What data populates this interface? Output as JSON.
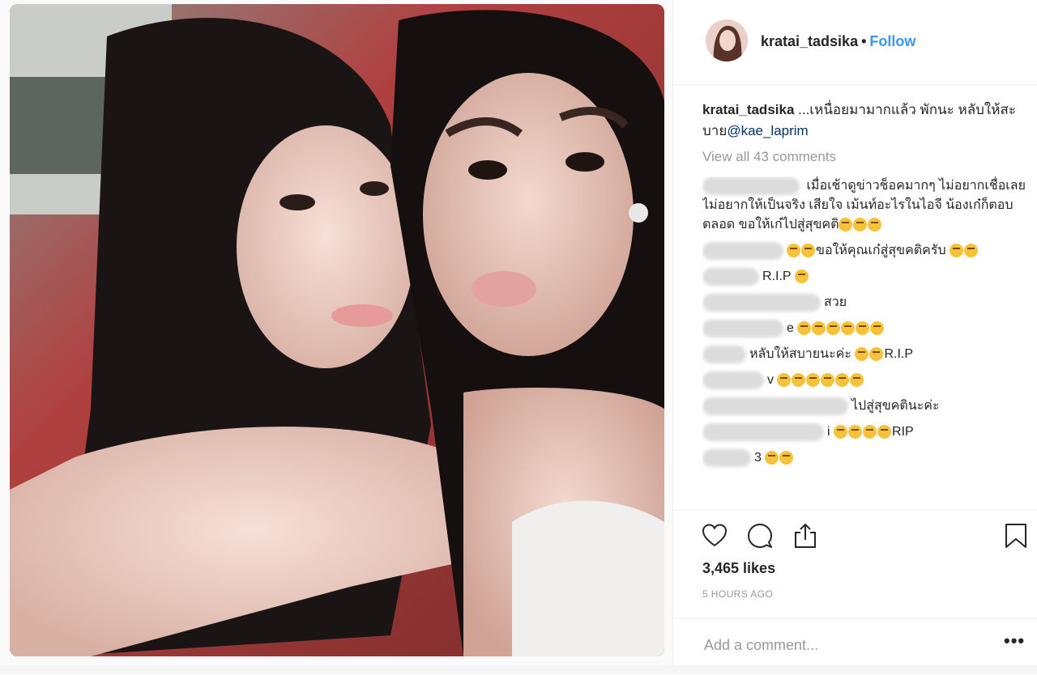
{
  "post": {
    "username": "kratai_tadsika",
    "separator": "•",
    "follow_label": "Follow",
    "caption_text": " ...เหนื่อยมามากแล้ว พักนะ หลับให้สะบาย",
    "caption_mention": "@kae_laprim",
    "view_all_comments": "View all 43 comments",
    "likes": "3,465 likes",
    "timestamp": "5 HOURS AGO",
    "add_comment_placeholder": "Add a comment...",
    "more_label": "•••"
  },
  "comments": [
    {
      "text": " เมื่อเช้าดูข่าวช็อคมากๆ ไม่อยากเชื่อเลยไม่อยากให้เป็นจริง เสียใจ เม้นท์อะไรในไอจี น้องเก๋ก็ตอบตลอด ขอให้เก๋ไปสู่สุขคติ"
    },
    {
      "text": "ขอให้คุณเก๋สู่สุขคติครับ"
    },
    {
      "text": "R.I.P"
    },
    {
      "text": "สวย"
    },
    {
      "text": "e"
    },
    {
      "text": "หลับให้สบายนะค่ะ"
    },
    {
      "text": "R.I.P"
    },
    {
      "text": "v"
    },
    {
      "text": "ไปสู่สุขคตินะค่ะ"
    },
    {
      "text": "i"
    },
    {
      "text": "RIP"
    },
    {
      "text": "3"
    }
  ],
  "colors": {
    "link": "#3897f0",
    "mention": "#003569",
    "muted": "#999999",
    "text": "#262626"
  },
  "icons": [
    "heart-icon",
    "comment-icon",
    "share-icon",
    "bookmark-icon"
  ]
}
